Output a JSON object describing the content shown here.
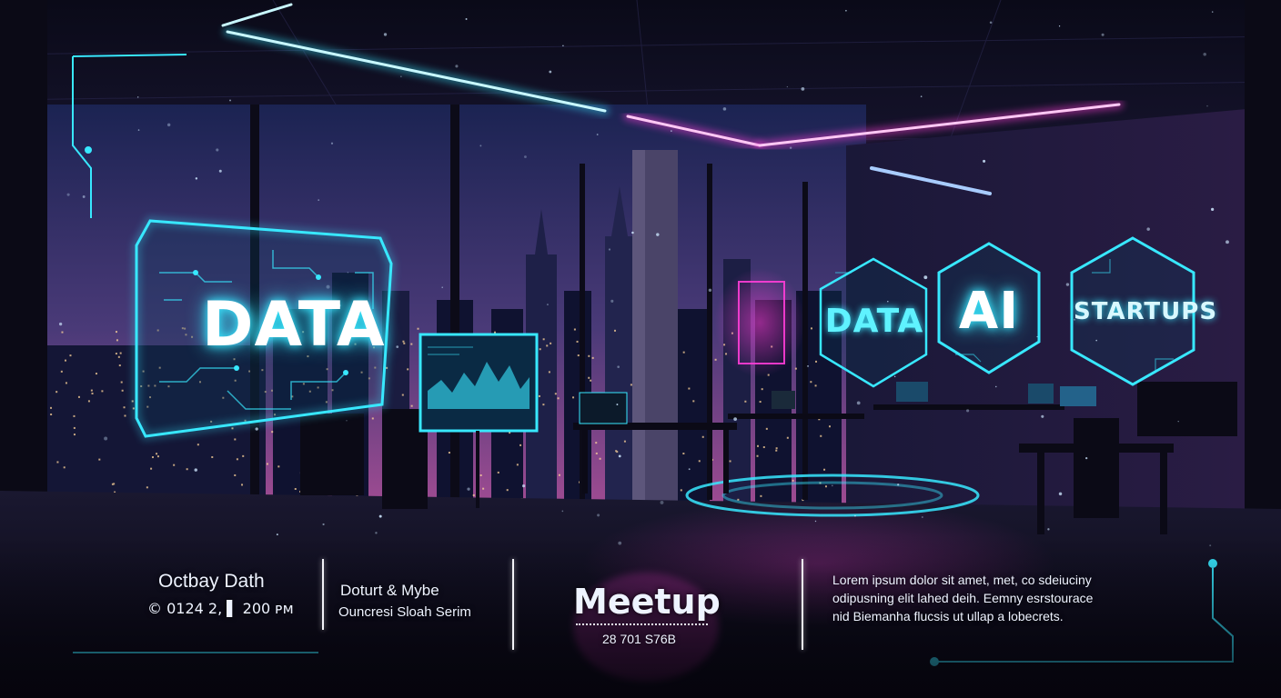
{
  "holograms": {
    "left_panel_label": "DATA",
    "hex_1_label": "DATA",
    "hex_2_label": "AI",
    "hex_3_label": "STARTUPS"
  },
  "info_bar": {
    "date_title": "Octbay Dath",
    "date_line": "© 0124 2, ▌ 200 ᴘᴍ",
    "venue_title": "Doturt & Mybe",
    "venue_line": "Ouncresi Sloah Serim",
    "event_title": "Meetup",
    "event_code": "28 701 S76B",
    "description_lines": [
      "Lorem ipsum dolor sit amet, met, co sdeiuciny",
      "odipusning elit lahed deih. Eemny esrstourace",
      "nid Biemanha flucsis ut ullap a lobecrets."
    ]
  },
  "colors": {
    "cyan_neon": "#38e8ff",
    "magenta_neon": "#ff3dd8",
    "sky_top": "#1c2250",
    "sky_bottom": "#9a4a9a",
    "floor": "#0e0c1c",
    "text_white": "#eef3ff"
  }
}
